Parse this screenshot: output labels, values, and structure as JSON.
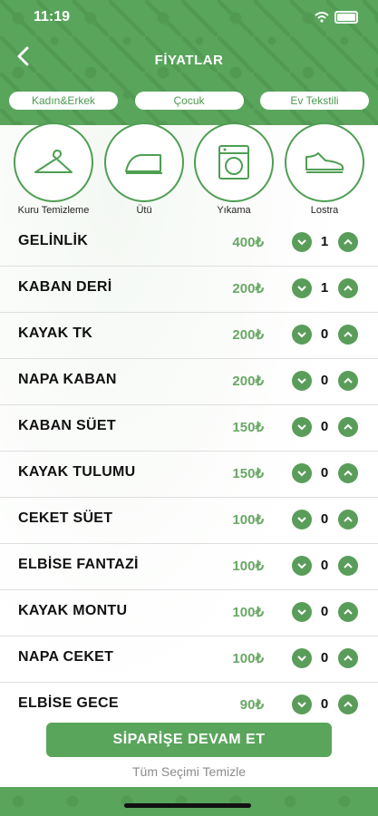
{
  "status_bar": {
    "time": "11:19"
  },
  "header": {
    "title": "FİYATLAR",
    "back_icon": "chevron-left-icon"
  },
  "tabs": [
    {
      "label": "Kadın&Erkek"
    },
    {
      "label": "Çocuk"
    },
    {
      "label": "Ev Tekstili"
    }
  ],
  "categories": [
    {
      "label": "Kuru Temizleme",
      "icon": "hanger-icon"
    },
    {
      "label": "Ütü",
      "icon": "iron-icon"
    },
    {
      "label": "Yıkama",
      "icon": "washing-machine-icon"
    },
    {
      "label": "Lostra",
      "icon": "shoe-icon"
    }
  ],
  "items": [
    {
      "name": "GELİNLİK",
      "price": "400₺",
      "qty": "1"
    },
    {
      "name": "KABAN DERİ",
      "price": "200₺",
      "qty": "1"
    },
    {
      "name": "KAYAK TK",
      "price": "200₺",
      "qty": "0"
    },
    {
      "name": "NAPA KABAN",
      "price": "200₺",
      "qty": "0"
    },
    {
      "name": "KABAN SÜET",
      "price": "150₺",
      "qty": "0"
    },
    {
      "name": "KAYAK TULUMU",
      "price": "150₺",
      "qty": "0"
    },
    {
      "name": "CEKET SÜET",
      "price": "100₺",
      "qty": "0"
    },
    {
      "name": "ELBİSE FANTAZİ",
      "price": "100₺",
      "qty": "0"
    },
    {
      "name": "KAYAK MONTU",
      "price": "100₺",
      "qty": "0"
    },
    {
      "name": "NAPA CEKET",
      "price": "100₺",
      "qty": "0"
    },
    {
      "name": "ELBİSE GECE",
      "price": "90₺",
      "qty": "0"
    }
  ],
  "actions": {
    "continue_label": "SİPARİŞE DEVAM ET",
    "clear_label": "Tüm Seçimi Temizle"
  },
  "colors": {
    "brand_green": "#5aa55c",
    "price_green": "#6aa766"
  }
}
